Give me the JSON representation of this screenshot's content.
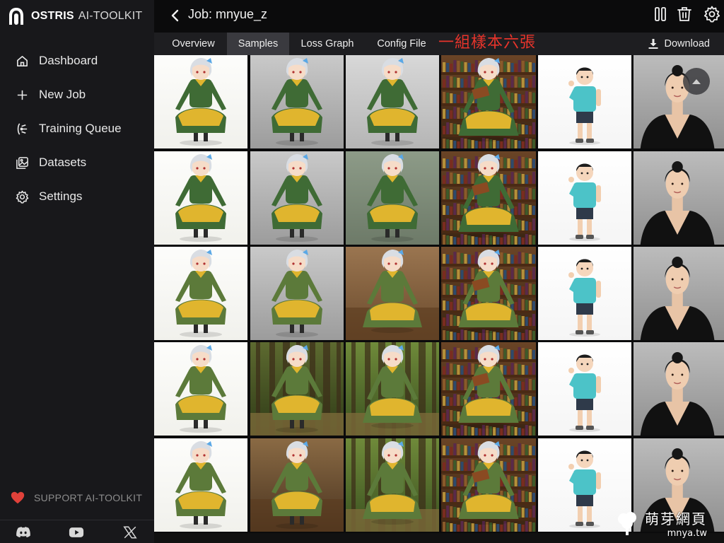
{
  "brand": {
    "name": "OSTRIS",
    "sub": "AI-TOOLKIT",
    "logo_icon": "ostris-logo-icon"
  },
  "sidebar": {
    "items": [
      {
        "label": "Dashboard",
        "icon": "home-icon"
      },
      {
        "label": "New Job",
        "icon": "plus-icon"
      },
      {
        "label": "Training Queue",
        "icon": "queue-icon"
      },
      {
        "label": "Datasets",
        "icon": "images-icon"
      },
      {
        "label": "Settings",
        "icon": "gear-icon"
      }
    ],
    "support_label": "SUPPORT AI-TOOLKIT",
    "social": [
      "discord-icon",
      "youtube-icon",
      "x-icon"
    ]
  },
  "header": {
    "title": "Job: mnyue_z",
    "actions": [
      "pause-icon",
      "trash-icon",
      "gear-icon"
    ]
  },
  "tabs": [
    {
      "label": "Overview",
      "active": false
    },
    {
      "label": "Samples",
      "active": true
    },
    {
      "label": "Loss Graph",
      "active": false
    },
    {
      "label": "Config File",
      "active": false
    }
  ],
  "annotation": "一組樣本六張",
  "download_label": "Download",
  "samples": {
    "columns": [
      "anime girl white background",
      "anime girl grey studio",
      "anime girl grey-green backdrop",
      "anime girl reading in library",
      "boy in teal t-shirt",
      "woman in black dress portrait"
    ],
    "rows": 5,
    "row3_variants": [
      "white",
      "grey",
      "wood room",
      "library",
      "boy",
      "woman"
    ],
    "row4_variants": [
      "white",
      "forest",
      "forest",
      "library",
      "boy",
      "woman"
    ],
    "row5_variants": [
      "white",
      "tavern",
      "forest path",
      "library",
      "boy",
      "woman"
    ]
  },
  "watermark": {
    "line1": "萌芽網頁",
    "line2": "mnya.tw"
  },
  "colors": {
    "accent_red": "#e8342b",
    "heart": "#e0413a",
    "sidebar_bg": "#18181b",
    "tab_active": "#3a3a3f"
  }
}
